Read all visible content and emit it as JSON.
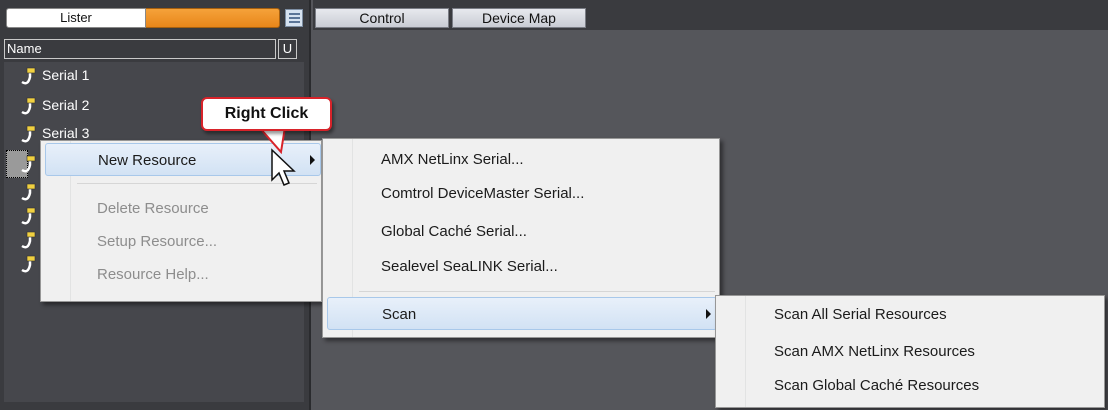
{
  "lister": {
    "tab_label": "Lister",
    "name_header": "Name",
    "u_header": "U",
    "items": [
      {
        "label": "Serial 1"
      },
      {
        "label": "Serial 2"
      },
      {
        "label": "Serial 3"
      },
      {
        "label": ""
      },
      {
        "label": ""
      },
      {
        "label": ""
      },
      {
        "label": ""
      },
      {
        "label": ""
      }
    ]
  },
  "tabs": [
    {
      "label": "Control"
    },
    {
      "label": "Device Map"
    }
  ],
  "callout": {
    "text": "Right Click"
  },
  "context_menu": {
    "items": [
      {
        "label": "New Resource",
        "enabled": true,
        "submenu": true,
        "highlighted": true
      },
      {
        "label": "Delete Resource",
        "enabled": false
      },
      {
        "label": "Setup Resource...",
        "enabled": false
      },
      {
        "label": "Resource Help...",
        "enabled": false
      }
    ]
  },
  "new_resource_menu": {
    "items": [
      {
        "label": "AMX NetLinx Serial..."
      },
      {
        "label": "Comtrol DeviceMaster Serial..."
      },
      {
        "label": "Global Caché Serial..."
      },
      {
        "label": "Sealevel SeaLINK Serial..."
      },
      {
        "label": "Scan",
        "submenu": true,
        "highlighted": true
      }
    ]
  },
  "scan_menu": {
    "items": [
      {
        "label": "Scan All Serial Resources"
      },
      {
        "label": "Scan AMX NetLinx Resources"
      },
      {
        "label": "Scan Global Caché Resources"
      }
    ]
  },
  "colors": {
    "accent_orange": "#f5a23a",
    "callout_border": "#d8232a",
    "highlight": "#d2e2f4"
  }
}
